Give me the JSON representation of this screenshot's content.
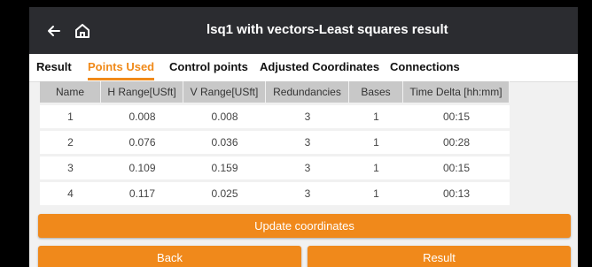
{
  "header": {
    "title": "lsq1 with vectors-Least squares result"
  },
  "tabs": [
    {
      "label": "Result",
      "active": false
    },
    {
      "label": "Points Used",
      "active": true
    },
    {
      "label": "Control points",
      "active": false
    },
    {
      "label": "Adjusted Coordinates",
      "active": false
    },
    {
      "label": "Connections",
      "active": false
    }
  ],
  "table": {
    "columns": [
      "Name",
      "H Range[USft]",
      "V Range[USft]",
      "Redundancies",
      "Bases",
      "Time Delta [hh:mm]"
    ],
    "rows": [
      [
        "1",
        "0.008",
        "0.008",
        "3",
        "1",
        "00:15"
      ],
      [
        "2",
        "0.076",
        "0.036",
        "3",
        "1",
        "00:28"
      ],
      [
        "3",
        "0.109",
        "0.159",
        "3",
        "1",
        "00:15"
      ],
      [
        "4",
        "0.117",
        "0.025",
        "3",
        "1",
        "00:13"
      ]
    ]
  },
  "buttons": {
    "update": "Update coordinates",
    "back": "Back",
    "result": "Result"
  },
  "colors": {
    "accent": "#f08a1a",
    "titlebar": "#2b2c30"
  },
  "icons": [
    "back-arrow-icon",
    "home-icon"
  ]
}
